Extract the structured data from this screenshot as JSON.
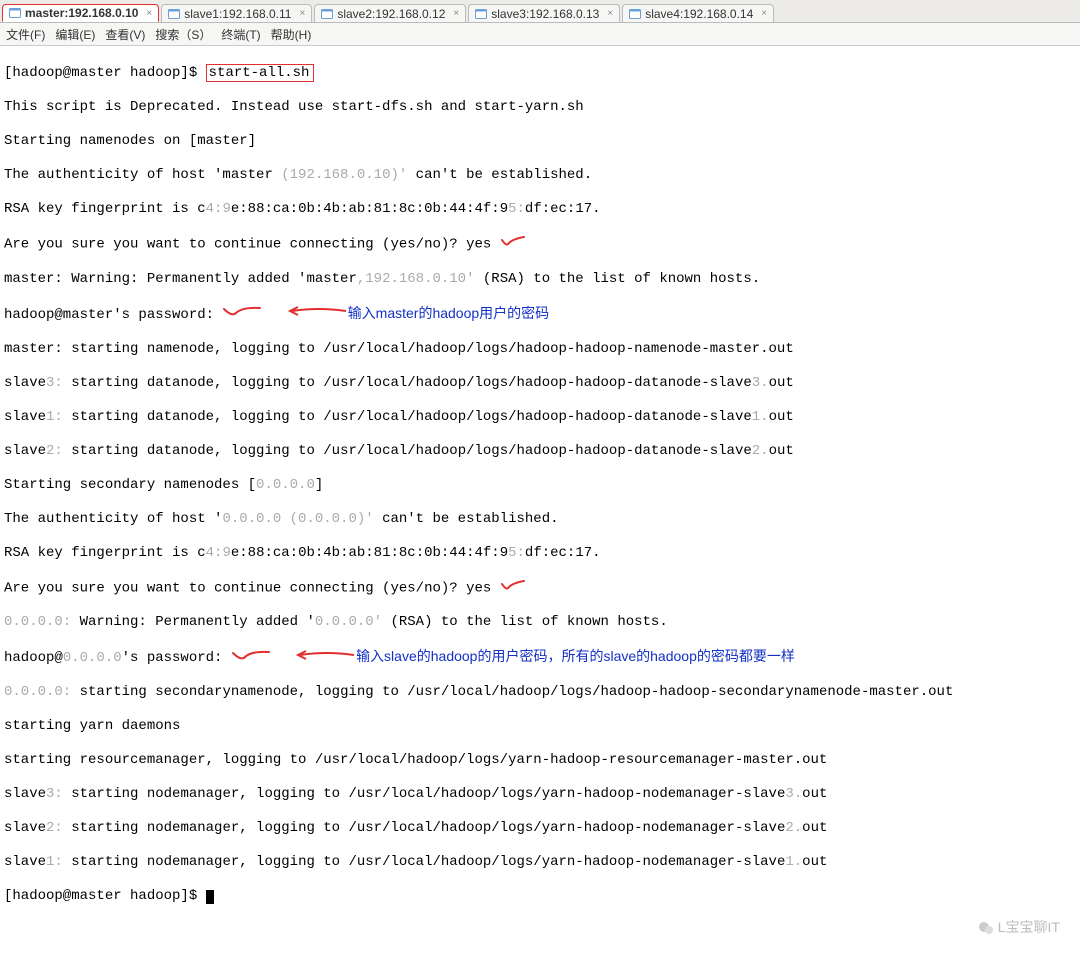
{
  "tabs": [
    {
      "label": "master:192.168.0.10",
      "active": true
    },
    {
      "label": "slave1:192.168.0.11",
      "active": false
    },
    {
      "label": "slave2:192.168.0.12",
      "active": false
    },
    {
      "label": "slave3:192.168.0.13",
      "active": false
    },
    {
      "label": "slave4:192.168.0.14",
      "active": false
    }
  ],
  "menu": {
    "file": "文件(F)",
    "edit": "编辑(E)",
    "view": "查看(V)",
    "search": "搜索（S）",
    "term": "终端(T)",
    "help": "帮助(H)"
  },
  "term": {
    "prompt_a": "[hadoop@master hadoop]$ ",
    "cmd": "start-all.sh",
    "l01": "This script is Deprecated. Instead use start-dfs.sh and start-yarn.sh",
    "l02": "Starting namenodes on [master]",
    "l03a": "The authenticity of host 'master ",
    "l03b": "(192.168.0.10)'",
    "l03c": " can't be established.",
    "l04a": "RSA key fingerprint is c",
    "l04b": "4:9",
    "l04c": "e:88:ca:0b:4b:ab:81:8c:0b:44:4f:9",
    "l04d": "5:",
    "l04e": "df:ec:17.",
    "l05": "Are you sure you want to continue connecting (yes/no)? yes",
    "l06a": "master: Warning: Permanently added 'master",
    "l06b": ",192.168.0.10'",
    "l06c": " (RSA) to the list of known hosts.",
    "l07": "hadoop@master's password: ",
    "l07_note": "输入master的hadoop用户的密码",
    "l08": "master: starting namenode, logging to /usr/local/hadoop/logs/hadoop-hadoop-namenode-master.out",
    "l09a": "slave",
    "l09b": "3:",
    "l09c": " starting datanode, logging to /usr/local/hadoop/logs/hadoop-hadoop-datanode-slave",
    "l09d": "3.",
    "l09e": "out",
    "l10a": "slave",
    "l10b": "1:",
    "l10c": " starting datanode, logging to /usr/local/hadoop/logs/hadoop-hadoop-datanode-slave",
    "l10d": "1.",
    "l10e": "out",
    "l11a": "slave",
    "l11b": "2:",
    "l11c": " starting datanode, logging to /usr/local/hadoop/logs/hadoop-hadoop-datanode-slave",
    "l11d": "2.",
    "l11e": "out",
    "l12a": "Starting secondary namenodes [",
    "l12b": "0.0.0.0",
    "l12c": "]",
    "l13a": "The authenticity of host '",
    "l13b": "0.0.0.0 (0.0.0.0)'",
    "l13c": " can't be established.",
    "l14a": "RSA key fingerprint is c",
    "l14b": "4:9",
    "l14c": "e:88:ca:0b:4b:ab:81:8c:0b:44:4f:9",
    "l14d": "5:",
    "l14e": "df:ec:17.",
    "l15": "Are you sure you want to continue connecting (yes/no)? yes",
    "l16a": "0.0.0.0:",
    "l16b": " Warning: Permanently added '",
    "l16c": "0.0.0.0'",
    "l16d": " (RSA) to the list of known hosts.",
    "l17a": "hadoop@",
    "l17b": "0.0.0.0",
    "l17c": "'s password: ",
    "l17_note": "输入slave的hadoop的用户密码，所有的slave的hadoop的密码都要一样",
    "l18a": "0.0.0.0:",
    "l18b": " starting secondarynamenode, logging to /usr/local/hadoop/logs/hadoop-hadoop-secondarynamenode-master.out",
    "l19": "starting yarn daemons",
    "l20": "starting resourcemanager, logging to /usr/local/hadoop/logs/yarn-hadoop-resourcemanager-master.out",
    "l21a": "slave",
    "l21b": "3:",
    "l21c": " starting nodemanager, logging to /usr/local/hadoop/logs/yarn-hadoop-nodemanager-slave",
    "l21d": "3.",
    "l21e": "out",
    "l22a": "slave",
    "l22b": "2:",
    "l22c": " starting nodemanager, logging to /usr/local/hadoop/logs/yarn-hadoop-nodemanager-slave",
    "l22d": "2.",
    "l22e": "out",
    "l23a": "slave",
    "l23b": "1:",
    "l23c": " starting nodemanager, logging to /usr/local/hadoop/logs/yarn-hadoop-nodemanager-slave",
    "l23d": "1.",
    "l23e": "out",
    "prompt_b": "[hadoop@master hadoop]$ "
  },
  "watermark": "L宝宝聊IT"
}
